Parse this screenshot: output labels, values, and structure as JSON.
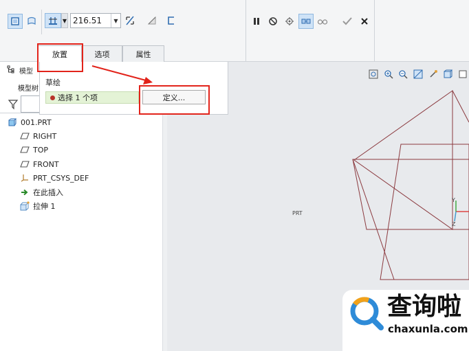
{
  "toolbar": {
    "depth_value": "216.51",
    "accent": "#3a82c8"
  },
  "tabs": [
    {
      "label": "放置"
    },
    {
      "label": "选项"
    },
    {
      "label": "属性"
    }
  ],
  "dashboard": {
    "section_label": "草绘",
    "collector_text": "选择 1 个项",
    "define_button": "定义..."
  },
  "left_panel": {
    "header_label": "模型",
    "sub_label": "模型树"
  },
  "tree": {
    "items": [
      {
        "label": "001.PRT",
        "icon": "part-icon"
      },
      {
        "label": "RIGHT",
        "icon": "datum-plane-icon"
      },
      {
        "label": "TOP",
        "icon": "datum-plane-icon"
      },
      {
        "label": "FRONT",
        "icon": "datum-plane-icon"
      },
      {
        "label": "PRT_CSYS_DEF",
        "icon": "csys-icon"
      },
      {
        "label": "在此插入",
        "icon": "insert-here-arrow-icon"
      },
      {
        "label": "拉伸 1",
        "icon": "extrude-icon"
      }
    ]
  },
  "csys_labels": {
    "x": "PRT",
    "y": "Y",
    "z": "Z"
  },
  "watermark": {
    "brand": "查询啦",
    "url": "chaxunla.com"
  },
  "colors": {
    "highlight_red": "#e2231a",
    "datum_plane_line": "#8b3a3f",
    "selected_field_bg": "#e4f3d6"
  }
}
